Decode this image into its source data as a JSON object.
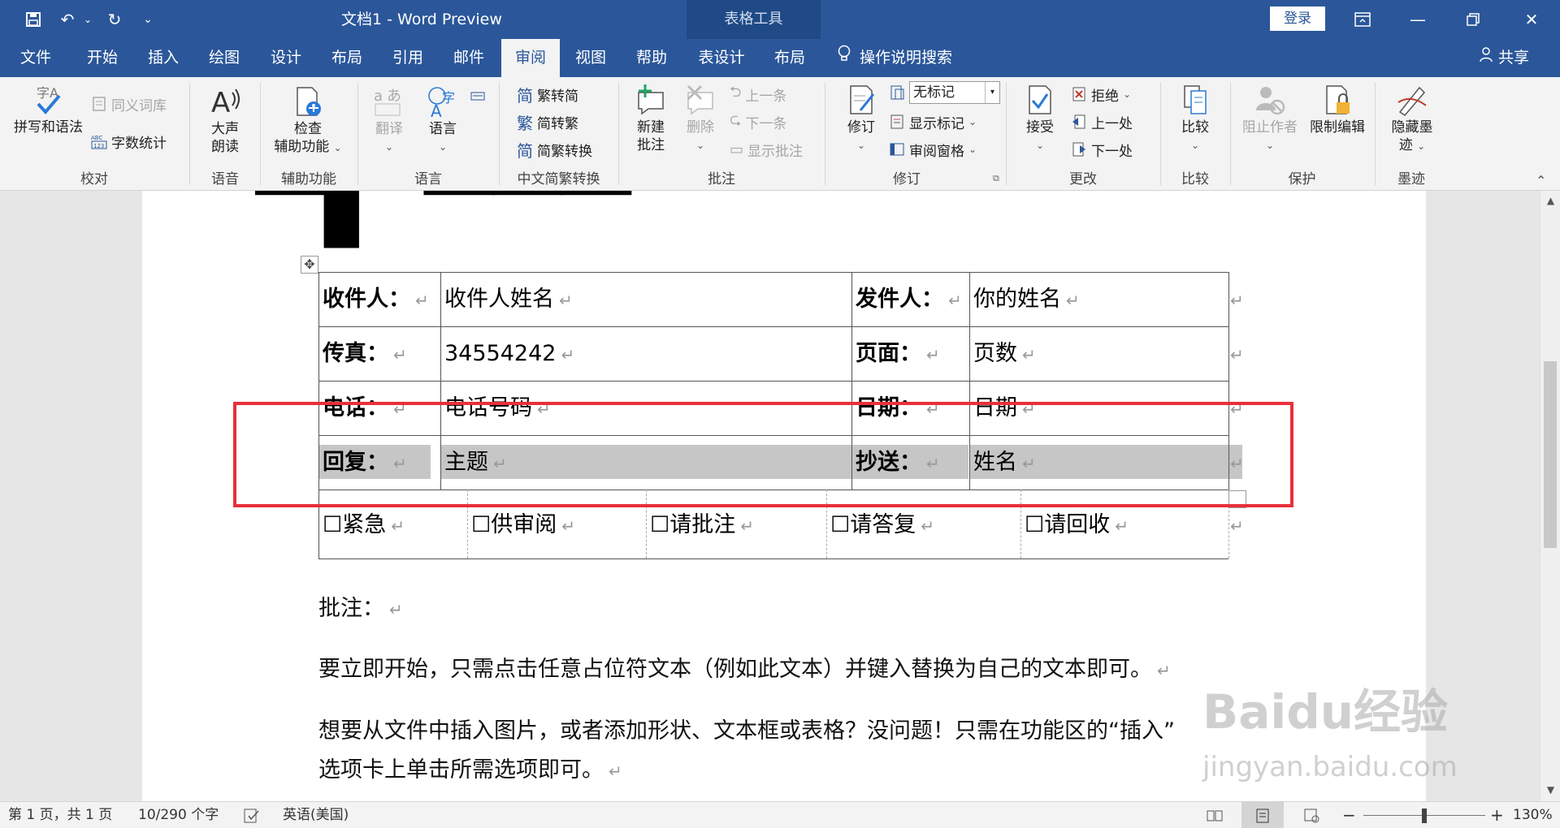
{
  "window": {
    "title": "文档1  -  Word Preview",
    "context_tools": "表格工具",
    "login": "登录"
  },
  "tabs": [
    "文件",
    "开始",
    "插入",
    "绘图",
    "设计",
    "布局",
    "引用",
    "邮件",
    "审阅",
    "视图",
    "帮助",
    "表设计",
    "布局"
  ],
  "active_tab": "审阅",
  "tell_me": "操作说明搜索",
  "share": "共享",
  "ribbon": {
    "proofing": {
      "label": "校对",
      "spell": "拼写和语法",
      "thesaurus": "同义词库",
      "wordcount": "字数统计"
    },
    "speech": {
      "label": "语音",
      "read_aloud_1": "大声",
      "read_aloud_2": "朗读"
    },
    "accessibility": {
      "label": "辅助功能",
      "check_1": "检查",
      "check_2": "辅助功能"
    },
    "language": {
      "label": "语言",
      "translate": "翻译",
      "language": "语言"
    },
    "chinese": {
      "label": "中文简繁转换",
      "to_simplified": "繁转简",
      "to_traditional": "简转繁",
      "convert": "简繁转换"
    },
    "comments": {
      "label": "批注",
      "new_1": "新建",
      "new_2": "批注",
      "delete": "删除",
      "prev": "上一条",
      "next": "下一条",
      "show": "显示批注"
    },
    "tracking": {
      "label": "修订",
      "track": "修订",
      "markup_value": "无标记",
      "show_markup": "显示标记",
      "reviewing_pane": "审阅窗格"
    },
    "changes": {
      "label": "更改",
      "accept": "接受",
      "reject": "拒绝",
      "previous": "上一处",
      "next": "下一处"
    },
    "compare": {
      "label": "比较",
      "compare": "比较"
    },
    "protect": {
      "label": "保护",
      "block_authors": "阻止作者",
      "restrict": "限制编辑"
    },
    "ink": {
      "label": "墨迹",
      "hide_1": "隐藏墨",
      "hide_2": "迹"
    }
  },
  "document": {
    "table": {
      "rows": [
        {
          "l_label": "收件人：",
          "l_value": "收件人姓名",
          "r_label": "发件人：",
          "r_value": "你的姓名"
        },
        {
          "l_label": "传真：",
          "l_value": "34554242",
          "r_label": "页面：",
          "r_value": "页数"
        },
        {
          "l_label": "电话：",
          "l_value": "电话号码",
          "r_label": "日期：",
          "r_value": "日期"
        },
        {
          "l_label": "回复：",
          "l_value": "主题",
          "r_label": "抄送：",
          "r_value": "姓名"
        }
      ],
      "checkboxes": [
        "☐紧急",
        "☐供审阅",
        "☐请批注",
        "☐请答复",
        "☐请回收"
      ]
    },
    "notes_label": "批注：",
    "para1": "要立即开始，只需点击任意占位符文本（例如此文本）并键入替换为自己的文本即可。",
    "para2_line1": "想要从文件中插入图片，或者添加形状、文本框或表格？没问题！只需在功能区的“插入”",
    "para2_line2": "选项卡上单击所需选项即可。",
    "watermark": "Baidu经验",
    "watermark_sub": "jingyan.baidu.com"
  },
  "status": {
    "page": "第 1 页，共 1 页",
    "words": "10/290 个字",
    "language": "英语(美国)",
    "zoom": "130%"
  },
  "colors": {
    "accent": "#2b579a",
    "highlight": "#e8303a"
  }
}
